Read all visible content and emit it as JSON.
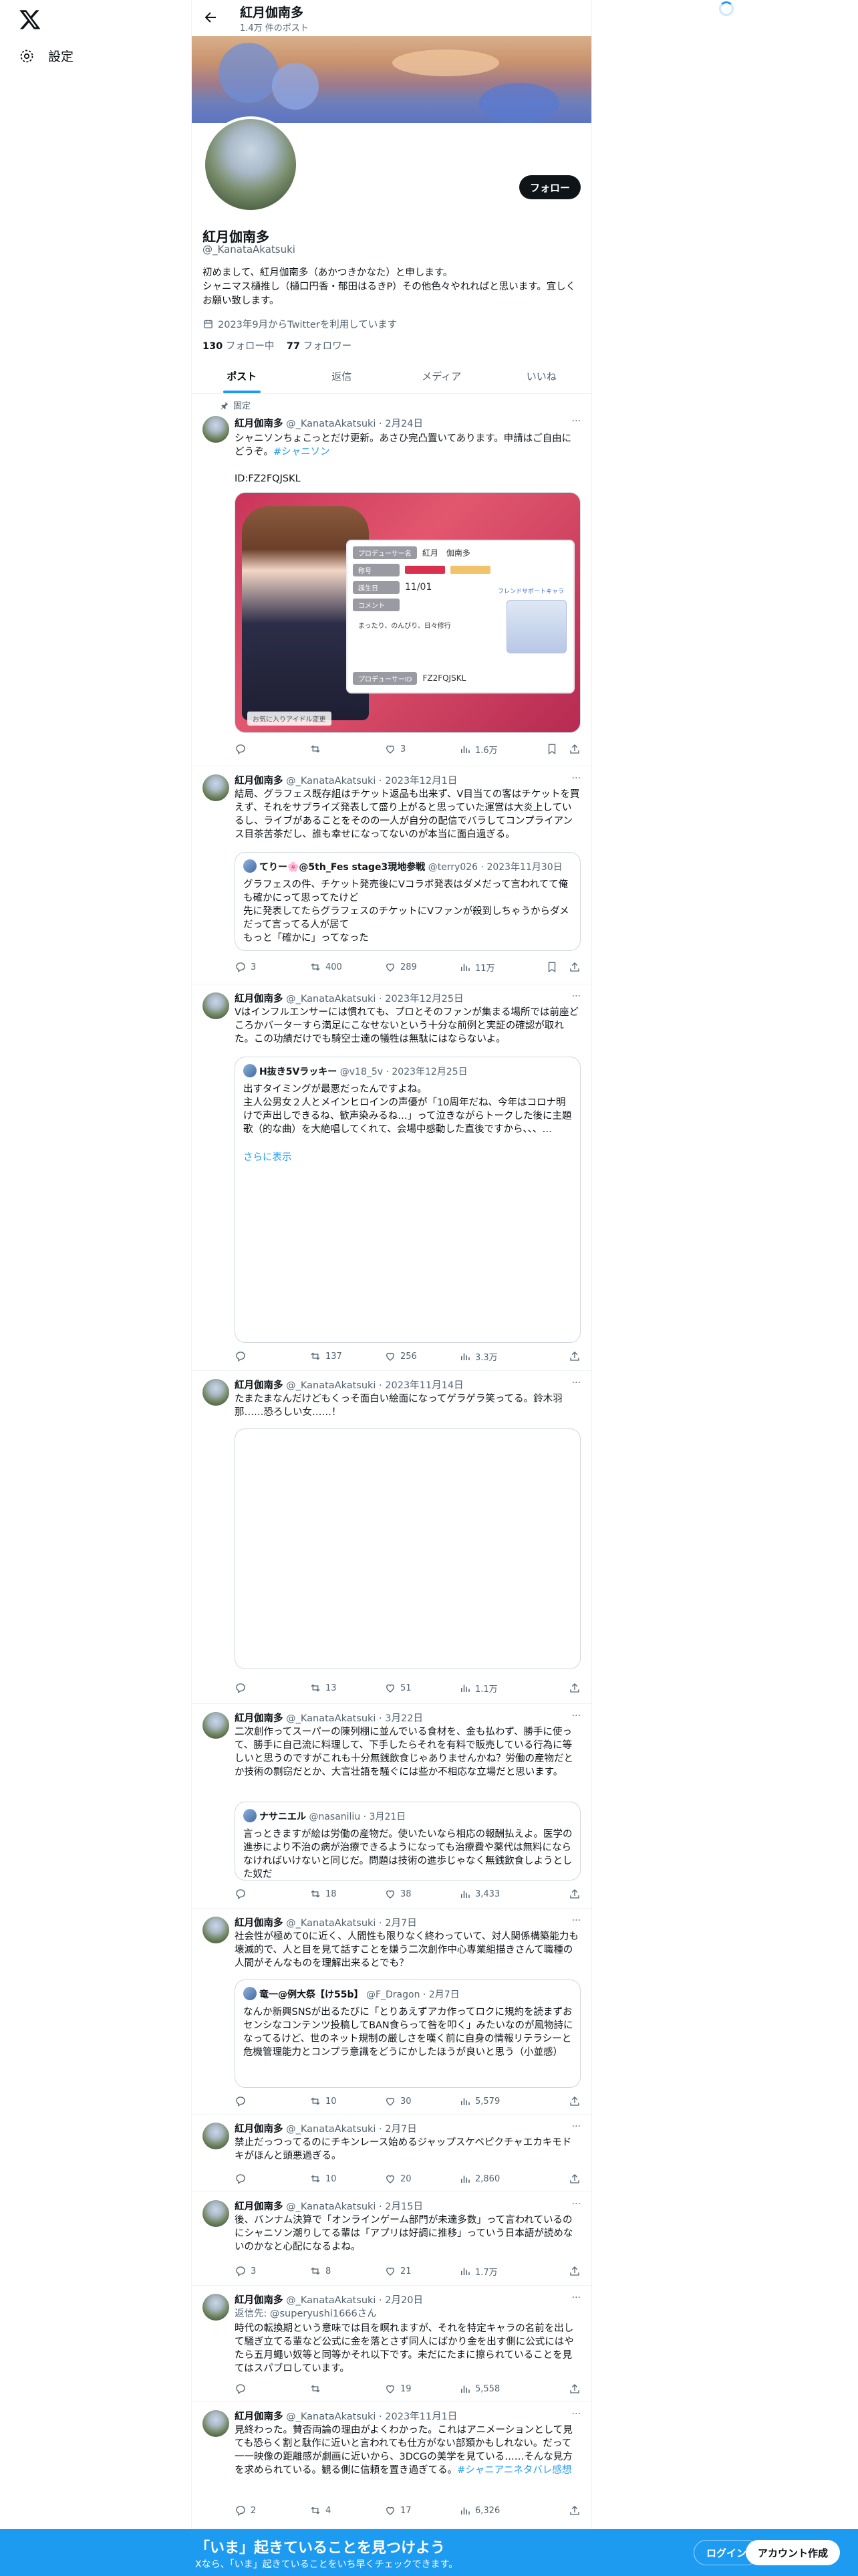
{
  "nav": {
    "settings": "設定"
  },
  "profile": {
    "name": "紅月伽南多",
    "post_count": "1.4万 件のポスト",
    "follow_button": "フォロー",
    "handle": "@_KanataAkatsuki",
    "bio": "初めまして、紅月伽南多（あかつきかなた）と申します。\nシャニマス樋推し（樋口円香・郁田はるきP）その他色々やれればと思います。宜しくお願い致します。",
    "joined": "2023年9月からTwitterを利用しています",
    "following_count": "130",
    "following_label": "フォロー中",
    "followers_count": "77",
    "followers_label": "フォロワー"
  },
  "tabs": [
    "ポスト",
    "返信",
    "メディア",
    "いいね"
  ],
  "pinned_label": "固定",
  "tweets": [
    {
      "name": "紅月伽南多",
      "meta": "@_KanataAkatsuki · 2月24日",
      "text": "シャニソンちょこっとだけ更新。あさひ完凸置いてあります。申請はご自由にどうぞ。",
      "hashtag": "#シャニソン",
      "text2": "ID:FZ2FQJSKL",
      "reply": "",
      "retweet": "",
      "like": "3",
      "views": "1.6万",
      "card": {
        "rows": [
          {
            "label": "プロデューサー名",
            "value": "紅月　伽南多"
          },
          {
            "label": "称号",
            "value": ""
          },
          {
            "label": "誕生日",
            "value": "11/01"
          },
          {
            "label": "コメント",
            "value": "まったり、のんびり、日々修行"
          },
          {
            "label": "プロデューサーID",
            "value": "FZ2FQJSKL"
          }
        ],
        "side_label": "フレンドサポートキャラ",
        "footer": "お気に入りアイドル変更"
      }
    },
    {
      "name": "紅月伽南多",
      "meta": "@_KanataAkatsuki · 2023年12月1日",
      "text": "結局、グラフェス既存組はチケット返品も出来ず、V目当ての客はチケットを買えず、それをサプライズ発表して盛り上がると思っていた運営は大炎上しているし、ライブがあることをそのの一人が自分の配信でバラしてコンプライアンス目茶苦茶だし、誰も幸せになってないのが本当に面白過ぎる。",
      "quote": {
        "name": "てりー🌸@5th_Fes stage3現地参戦",
        "meta": "@terry026 · 2023年11月30日",
        "text": "グラフェスの件、チケット発売後にVコラボ発表はダメだって言われてて俺も確かにって思ってたけど\n先に発表してたらグラフェスのチケットにVファンが殺到しちゃうからダメだって言ってる人が居て\nもっと「確かに」ってなった"
      },
      "reply": "3",
      "retweet": "400",
      "like": "289",
      "views": "11万"
    },
    {
      "name": "紅月伽南多",
      "meta": "@_KanataAkatsuki · 2023年12月25日",
      "text": "Vはインフルエンサーには慣れても、プロとそのファンが集まる場所では前座どころかバーターすら満足にこなせないという十分な前例と実証の確認が取れた。この功績だけでも騎空士達の犠牲は無駄にはならないよ。",
      "quote": {
        "name": "H抜き5Vラッキー",
        "meta": "@v18_5v · 2023年12月25日",
        "text": "出すタイミングが最悪だったんですよね。\n主人公男女２人とメインヒロインの声優が「10周年だね、今年はコロナ明けで声出しできるね、歓声染みるね…」って泣きながらトークした後に主題歌（的な曲）を大絶唱してくれて、会場中感動した直後ですから、、、…",
        "showmore": "さらに表示"
      },
      "reply": "",
      "retweet": "137",
      "like": "256",
      "views": "3.3万"
    },
    {
      "name": "紅月伽南多",
      "meta": "@_KanataAkatsuki · 2023年11月14日",
      "text": "たまたまなんだけどもくっそ面白い絵面になってゲラゲラ笑ってる。鈴木羽那……恐ろしい女……！",
      "reply": "",
      "retweet": "13",
      "like": "51",
      "views": "1.1万"
    },
    {
      "name": "紅月伽南多",
      "meta": "@_KanataAkatsuki · 3月22日",
      "text": "二次創作ってスーパーの陳列棚に並んでいる食材を、金も払わず、勝手に使って、勝手に自己流に料理して、下手したらそれを有料で販売している行為に等しいと思うのですがこれも十分無銭飲食じゃありませんかね？労働の産物だとか技術の剽窃だとか、大言壮語を騒ぐには些か不相応な立場だと思います。",
      "quote": {
        "name": "ナサニエル",
        "meta": "@nasaniliu · 3月21日",
        "text": "言っときますが絵は労働の産物だ。使いたいなら相応の報酬払えよ。医学の進歩により不治の病が治療できるようになっても治療費や薬代は無料にならなければいけないと同じだ。問題は技術の進歩じゃなく無銭飲食しようとした奴だ"
      },
      "reply": "",
      "retweet": "18",
      "like": "38",
      "views": "3,433"
    },
    {
      "name": "紅月伽南多",
      "meta": "@_KanataAkatsuki · 2月7日",
      "text": "社会性が極めて0に近く、人間性も限りなく終わっていて、対人関係構築能力も壊滅的で、人と目を見て話すことを嫌う二次創作中心専業組描きさんて職種の人間がそんなものを理解出来るとでも？",
      "quote": {
        "name": "竜一@例大祭【け55b】",
        "meta": "@F_Dragon · 2月7日",
        "text": "なんか新興SNSが出るたびに「とりあえずアカ作ってロクに規約を読まずおセンシなコンテンツ投稿してBAN食らって咎を叩く」みたいなのが風物詩になってるけど、世のネット規制の厳しさを嘆く前に自身の情報リテラシーと危機管理能力とコンプラ意識をどうにかしたほうが良いと思う（小並感）"
      },
      "reply": "",
      "retweet": "10",
      "like": "30",
      "views": "5,579"
    },
    {
      "name": "紅月伽南多",
      "meta": "@_KanataAkatsuki · 2月7日",
      "text": "禁止だっつってるのにチキンレース始めるジャップスケベピクチャエカキモドキがほんと頭悪過ぎる。",
      "reply": "",
      "retweet": "10",
      "like": "20",
      "views": "2,860"
    },
    {
      "name": "紅月伽南多",
      "meta": "@_KanataAkatsuki · 2月15日",
      "text": "後、バンナム決算で「オンラインゲーム部門が未達多数」って言われているのにシャニソン潮りしてる輩は「アプリは好調に推移」っていう日本語が読めないのかなと心配になるよね。",
      "reply": "3",
      "retweet": "8",
      "like": "21",
      "views": "1.7万"
    },
    {
      "name": "紅月伽南多",
      "meta": "@_KanataAkatsuki · 2月20日",
      "reply_to": "返信先: @superyushi1666さん",
      "text": "時代の転換期という意味では目を瞑れますが、それを特定キャラの名前を出して騒ぎ立てる輩など公式に金を落とさず同人にばかり金を出す側に公式にはやたら五月蠅い奴等と同等かそれ以下です。未だにたまに擦られていることを見てはスパブロしています。",
      "reply": "",
      "retweet": "",
      "like": "19",
      "views": "5,558"
    },
    {
      "name": "紅月伽南多",
      "meta": "@_KanataAkatsuki · 2023年11月1日",
      "text": "見終わった。賛否両論の理由がよくわかった。これはアニメーションとして見ても恐らく割と駄作に近いと言われても仕方がない部類かもしれない。だって一一映像の距離感が劇画に近いから、3DCGの美学を見ている……そんな見方を求められている。観る側に信頼を置き過ぎてる。",
      "hashtag": "#シャニアニネタバレ感想",
      "reply": "2",
      "retweet": "4",
      "like": "17",
      "views": "6,326"
    }
  ],
  "bottom": {
    "title": "「いま」起きていることを見つけよう",
    "subtitle": "Xなら、「いま」起きていることをいち早くチェックできます。",
    "login": "ログイン",
    "signup": "アカウント作成"
  }
}
